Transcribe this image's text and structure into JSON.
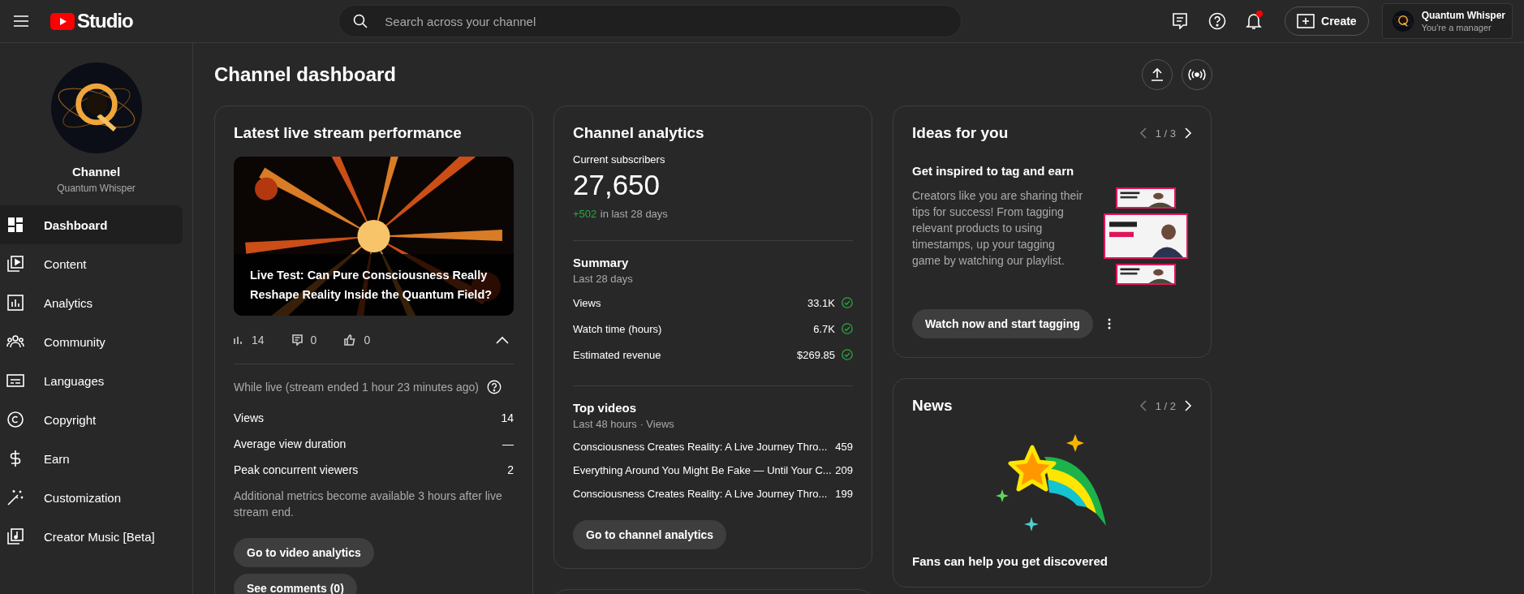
{
  "topbar": {
    "logo_text": "Studio",
    "search": {
      "placeholder": "Search across your channel"
    },
    "has_notification": true,
    "create_button": "Create",
    "account": {
      "name": "Quantum Whisper",
      "role": "You're a manager"
    }
  },
  "sidebar": {
    "channel_title": "Channel",
    "channel_name": "Quantum Whisper",
    "items": [
      {
        "label": "Dashboard",
        "selected": true
      },
      {
        "label": "Content",
        "selected": false
      },
      {
        "label": "Analytics",
        "selected": false
      },
      {
        "label": "Community",
        "selected": false
      },
      {
        "label": "Languages",
        "selected": false
      },
      {
        "label": "Copyright",
        "selected": false
      },
      {
        "label": "Earn",
        "selected": false
      },
      {
        "label": "Customization",
        "selected": false
      },
      {
        "label": "Creator Music [Beta]",
        "selected": false
      }
    ]
  },
  "page_title": "Channel dashboard",
  "live_card": {
    "title": "Latest live stream performance",
    "video_title": "Live Test: Can Pure Consciousness Really Reshape Reality Inside the Quantum Field?",
    "stats": {
      "views": "14",
      "comments": "0",
      "likes": "0"
    },
    "expanded": true,
    "while_live": "While live (stream ended 1 hour 23 minutes ago)",
    "metrics": [
      {
        "label": "Views",
        "value": "14"
      },
      {
        "label": "Average view duration",
        "value": "—"
      },
      {
        "label": "Peak concurrent viewers",
        "value": "2"
      }
    ],
    "note": "Additional metrics become available 3 hours after live stream end.",
    "buttons": [
      "Go to video analytics",
      "See comments (0)"
    ]
  },
  "analytics_card": {
    "title": "Channel analytics",
    "subscribers_label": "Current subscribers",
    "subscribers": "27,650",
    "delta": "+502",
    "delta_text": "in last 28 days",
    "summary": {
      "title": "Summary",
      "period": "Last 28 days",
      "rows": [
        {
          "label": "Views",
          "value": "33.1K",
          "on_track": true
        },
        {
          "label": "Watch time (hours)",
          "value": "6.7K",
          "on_track": true
        },
        {
          "label": "Estimated revenue",
          "value": "$269.85",
          "on_track": true
        }
      ]
    },
    "top_videos": {
      "title": "Top videos",
      "period": "Last 48 hours · Views",
      "rows": [
        {
          "title": "Consciousness Creates Reality: A Live Journey Thro...",
          "views": "459"
        },
        {
          "title": "Everything Around You Might Be Fake — Until Your C...",
          "views": "209"
        },
        {
          "title": "Consciousness Creates Reality: A Live Journey Thro...",
          "views": "199"
        }
      ]
    },
    "button": "Go to channel analytics"
  },
  "ideas_card": {
    "title": "Ideas for you",
    "pager": "1 / 3",
    "heading": "Get inspired to tag and earn",
    "body": "Creators like you are sharing their tips for success! From tagging relevant products to using timestamps, up your tagging game by watching our playlist.",
    "button": "Watch now and start tagging"
  },
  "news_card": {
    "title": "News",
    "pager": "1 / 2",
    "headline": "Fans can help you get discovered"
  }
}
